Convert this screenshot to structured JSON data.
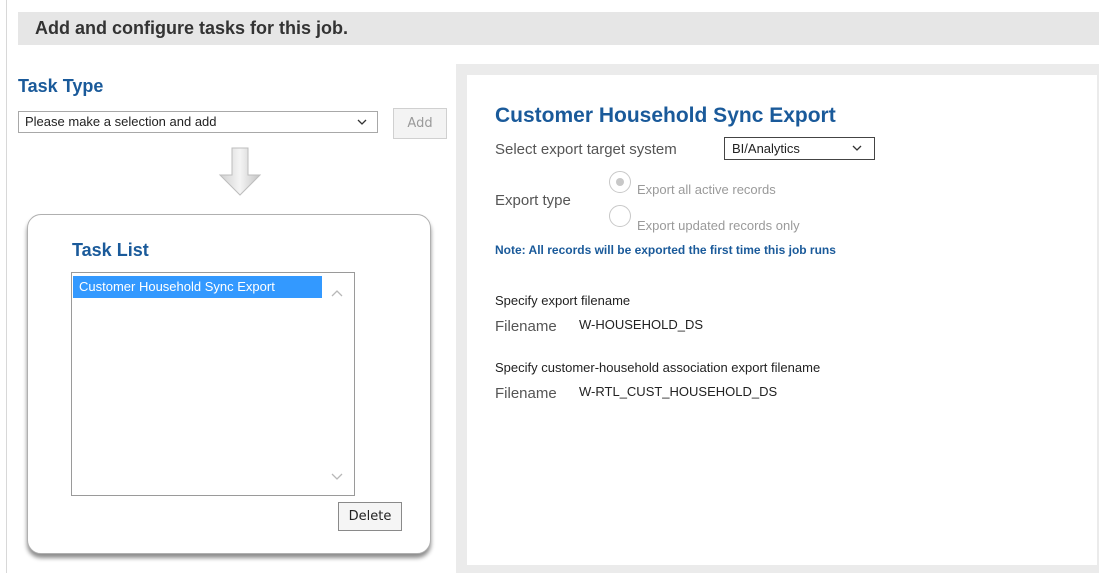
{
  "header": {
    "title": "Add and configure tasks for this job."
  },
  "task_type": {
    "title": "Task Type",
    "select_value": "Please make a selection and add",
    "add_label": "Add"
  },
  "task_list": {
    "title": "Task List",
    "items": [
      "Customer Household Sync Export"
    ],
    "delete_label": "Delete"
  },
  "export": {
    "title": "Customer Household Sync Export",
    "target_label": "Select export target system",
    "target_value": "BI/Analytics",
    "type_label": "Export type",
    "options": [
      {
        "label": "Export all active records",
        "selected": true
      },
      {
        "label": "Export updated records only",
        "selected": false
      }
    ],
    "note": "Note: All records will be exported the first time this job runs",
    "file1_heading": "Specify export filename",
    "file1_label": "Filename",
    "file1_value": "W-HOUSEHOLD_DS",
    "file2_heading": "Specify customer-household association export filename",
    "file2_label": "Filename",
    "file2_value": "W-RTL_CUST_HOUSEHOLD_DS"
  },
  "colors": {
    "accent": "#1a5a9a",
    "selection": "#3399ff",
    "header_bg": "#e6e6e6"
  }
}
